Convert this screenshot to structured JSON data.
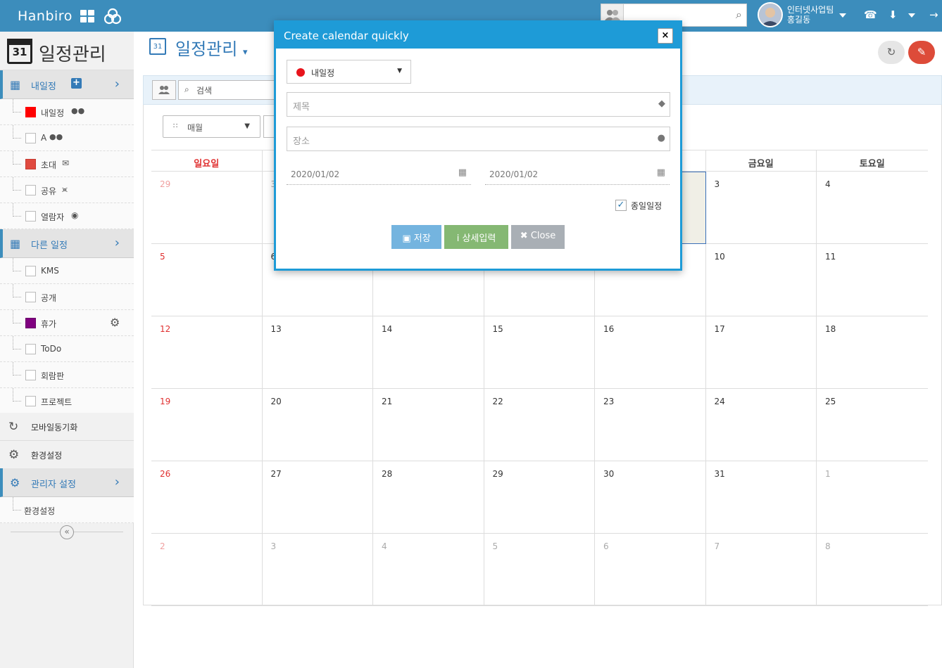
{
  "topbar": {
    "brand": "Hanbiro",
    "user_org": "인터넷사업팀",
    "user_name": "홍길동",
    "search_placeholder": ""
  },
  "sidebar": {
    "title": "일정관리",
    "my_section": "내일정",
    "my_items": [
      {
        "label": "내일정",
        "color": "#ff0000"
      },
      {
        "label": "A",
        "color": ""
      },
      {
        "label": "초대",
        "color": "#e04a3f"
      },
      {
        "label": "공유",
        "color": ""
      },
      {
        "label": "열람자",
        "color": ""
      }
    ],
    "other_section": "다른 일정",
    "other_items": [
      {
        "label": "KMS",
        "color": ""
      },
      {
        "label": "공개",
        "color": ""
      },
      {
        "label": "휴가",
        "color": "#800080"
      },
      {
        "label": "ToDo",
        "color": ""
      },
      {
        "label": "회람판",
        "color": ""
      },
      {
        "label": "프로젝트",
        "color": ""
      }
    ],
    "mobile_sync": "모바일동기화",
    "settings": "환경설정",
    "admin_section": "관리자 설정",
    "admin_settings": "환경설정"
  },
  "main": {
    "title": "일정관리",
    "search_label": "검색",
    "view_label": "매월",
    "weekdays": [
      "일요일",
      "",
      "",
      "",
      "",
      "금요일",
      "토요일"
    ],
    "weeks": [
      [
        "29",
        "3",
        "",
        "",
        "",
        "3",
        "4"
      ],
      [
        "5",
        "6",
        "",
        "",
        "",
        "10",
        "11"
      ],
      [
        "12",
        "13",
        "14",
        "15",
        "16",
        "17",
        "18"
      ],
      [
        "19",
        "20",
        "21",
        "22",
        "23",
        "24",
        "25"
      ],
      [
        "26",
        "27",
        "28",
        "29",
        "30",
        "31",
        "1"
      ],
      [
        "2",
        "3",
        "4",
        "5",
        "6",
        "7",
        "8"
      ]
    ]
  },
  "modal": {
    "title": "Create calendar quickly",
    "close_x": "×",
    "calendar_select": "내일정",
    "title_placeholder": "제목",
    "location_placeholder": "장소",
    "start_date": "2020/01/02",
    "end_date": "2020/01/02",
    "allday_label": "종일일정",
    "allday_checked": true,
    "save_label": "저장",
    "detail_label": "상세입력",
    "close_label": "Close"
  },
  "colors": {
    "accent": "#3c8dbc",
    "modal_header": "#1e9bd7",
    "save_btn": "#74b4df",
    "detail_btn": "#85b873",
    "close_btn": "#a9afb5",
    "sunday": "#e03030"
  }
}
